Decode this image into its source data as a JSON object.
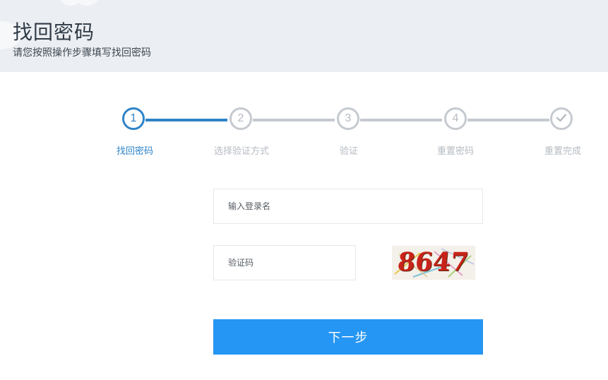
{
  "header": {
    "title": "找回密码",
    "subtitle": "请您按照操作步骤填写找回密码"
  },
  "steps": [
    {
      "number": "1",
      "label": "找回密码",
      "state": "active"
    },
    {
      "number": "2",
      "label": "选择验证方式",
      "state": "pending"
    },
    {
      "number": "3",
      "label": "验证",
      "state": "pending"
    },
    {
      "number": "4",
      "label": "重置密码",
      "state": "pending"
    },
    {
      "number": "",
      "label": "重置完成",
      "state": "pending",
      "icon": "check-icon"
    }
  ],
  "form": {
    "username_placeholder": "输入登录名",
    "captcha_placeholder": "验证码",
    "captcha_image_text": "8647",
    "next_label": "下一步"
  },
  "colors": {
    "accent": "#2e84c9",
    "button": "#2596f3",
    "inactive": "#c5cad0",
    "header_bg": "#ebeef2"
  }
}
